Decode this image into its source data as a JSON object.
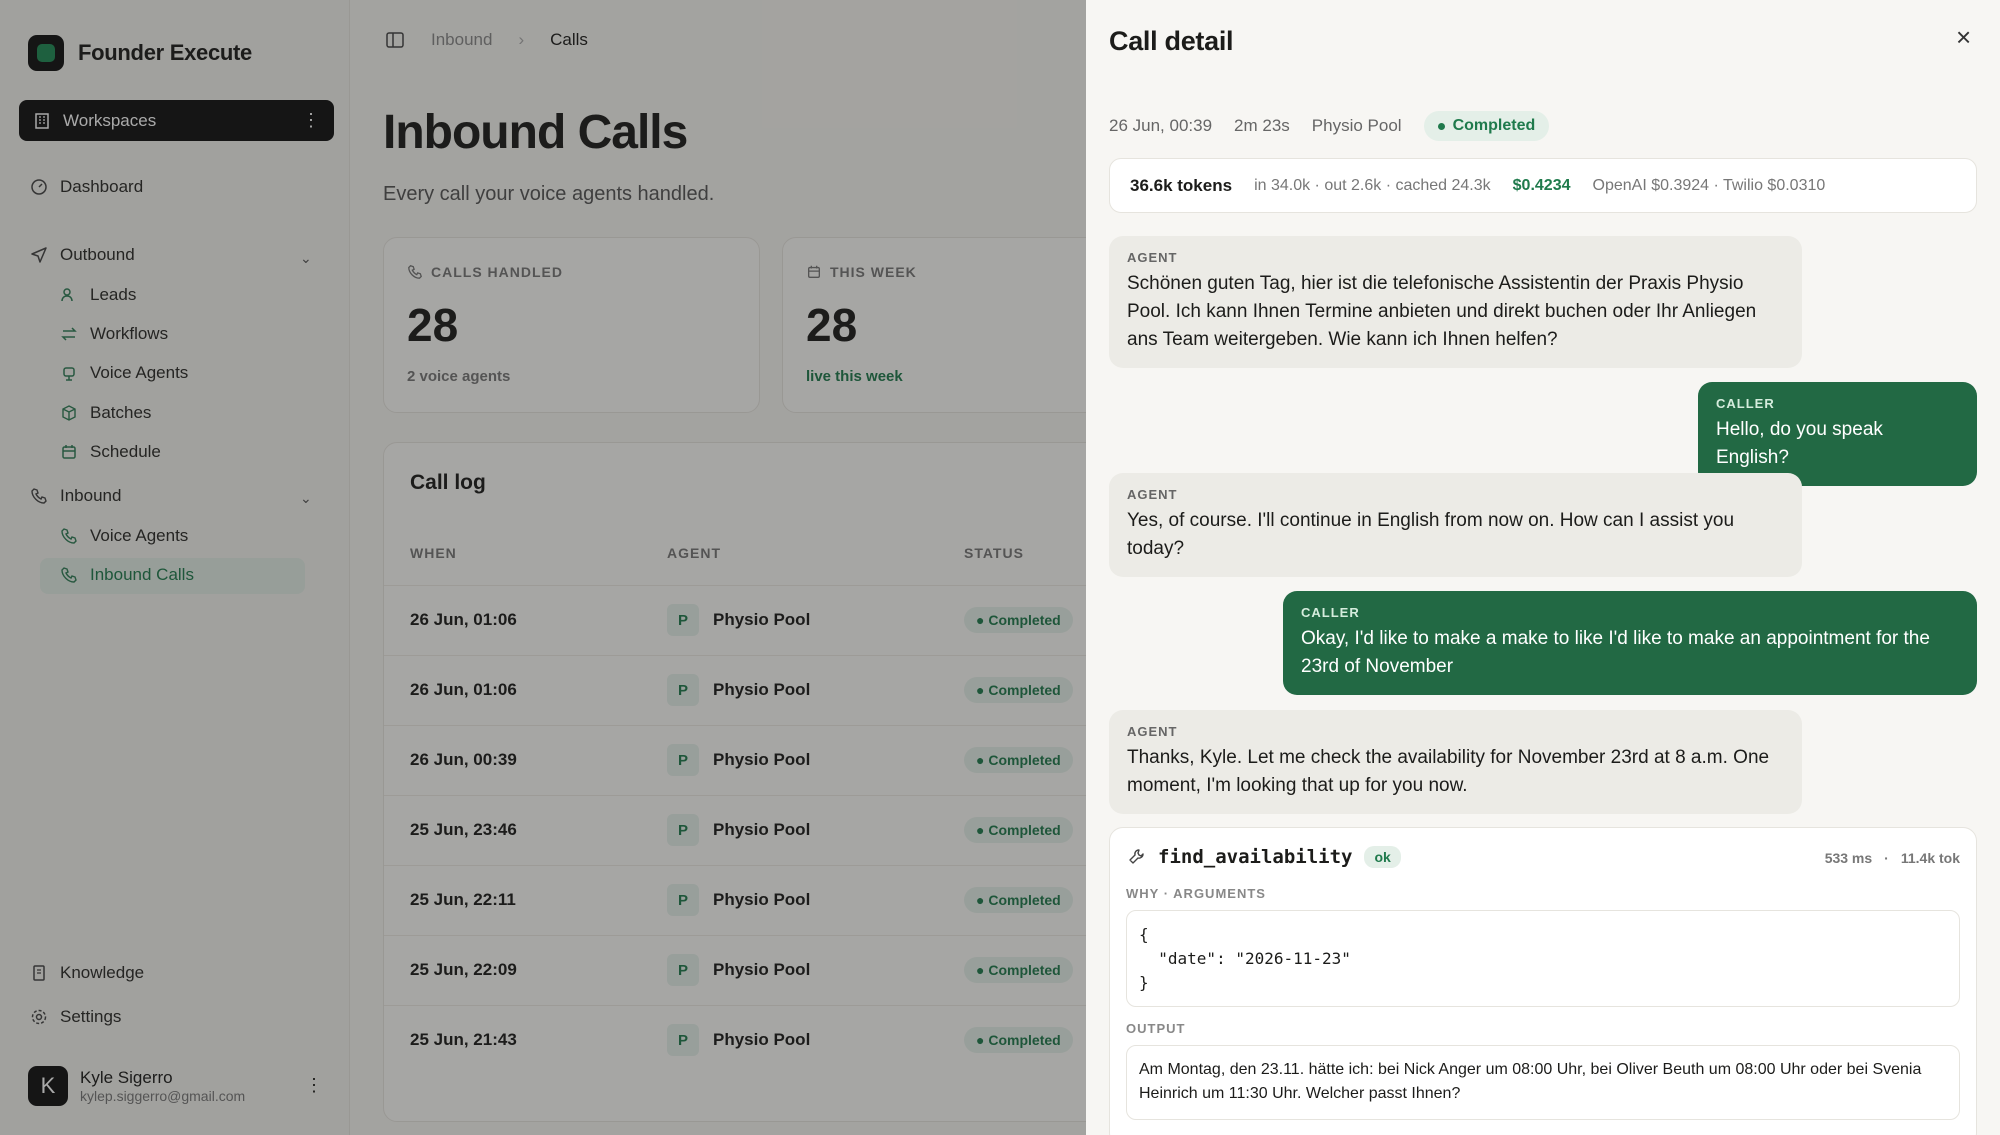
{
  "sidebar": {
    "brand": "Founder Execute",
    "workspace_label": "Workspaces",
    "dashboard": "Dashboard",
    "outbound": {
      "label": "Outbound",
      "items": [
        "Leads",
        "Workflows",
        "Voice Agents",
        "Batches",
        "Schedule"
      ]
    },
    "inbound": {
      "label": "Inbound",
      "items": [
        "Voice Agents",
        "Inbound Calls"
      ]
    },
    "knowledge": "Knowledge",
    "settings": "Settings",
    "user": {
      "initial": "K",
      "name": "Kyle Sigerro",
      "email": "kylep.siggerro@gmail.com"
    }
  },
  "breadcrumb": [
    "Inbound",
    "Calls"
  ],
  "page": {
    "title": "Inbound Calls",
    "subtitle": "Every call your voice agents handled."
  },
  "stats": [
    {
      "label": "CALLS HANDLED",
      "value": "28",
      "note": "2 voice agents"
    },
    {
      "label": "THIS WEEK",
      "value": "28",
      "note": "live this week"
    }
  ],
  "call_log": {
    "title": "Call log",
    "columns": [
      "WHEN",
      "AGENT",
      "STATUS"
    ],
    "rows": [
      {
        "when": "26 Jun, 01:06",
        "agent_initial": "P",
        "agent": "Physio Pool",
        "status": "Completed"
      },
      {
        "when": "26 Jun, 01:06",
        "agent_initial": "P",
        "agent": "Physio Pool",
        "status": "Completed"
      },
      {
        "when": "26 Jun, 00:39",
        "agent_initial": "P",
        "agent": "Physio Pool",
        "status": "Completed"
      },
      {
        "when": "25 Jun, 23:46",
        "agent_initial": "P",
        "agent": "Physio Pool",
        "status": "Completed"
      },
      {
        "when": "25 Jun, 22:11",
        "agent_initial": "P",
        "agent": "Physio Pool",
        "status": "Completed"
      },
      {
        "when": "25 Jun, 22:09",
        "agent_initial": "P",
        "agent": "Physio Pool",
        "status": "Completed"
      },
      {
        "when": "25 Jun, 21:43",
        "agent_initial": "P",
        "agent": "Physio Pool",
        "status": "Completed"
      }
    ]
  },
  "detail": {
    "title": "Call detail",
    "when": "26 Jun, 00:39",
    "duration": "2m 23s",
    "agent": "Physio Pool",
    "status": "Completed",
    "tokens": {
      "total": "36.6k tokens",
      "breakdown": "in 34.0k · out 2.6k · cached 24.3k",
      "cost": "$0.4234",
      "providers": "OpenAI $0.3924 · Twilio $0.0310"
    },
    "messages": [
      {
        "role": "AGENT",
        "text": "Schönen guten Tag, hier ist die telefonische Assistentin der Praxis Physio Pool. Ich kann Ihnen Termine anbieten und direkt buchen oder Ihr Anliegen ans Team weitergeben. Wie kann ich Ihnen helfen?"
      },
      {
        "role": "CALLER",
        "text": "Hello, do you speak English?"
      },
      {
        "role": "AGENT",
        "text": "Yes, of course. I'll continue in English from now on. How can I assist you today?"
      },
      {
        "role": "CALLER",
        "text": "Okay, I'd like to make a make to like I'd like to make an appointment for the 23rd of November"
      },
      {
        "role": "AGENT",
        "text": "Thanks, Kyle. Let me check the availability for November 23rd at 8 a.m. One moment, I'm looking that up for you now."
      }
    ],
    "tool": {
      "name": "find_availability",
      "status": "ok",
      "latency": "533 ms",
      "tokens": "11.4k tok",
      "args_label": "WHY · ARGUMENTS",
      "args": "{\n  \"date\": \"2026-11-23\"\n}",
      "output_label": "OUTPUT",
      "output": "Am Montag, den 23.11. hätte ich: bei Nick Anger um 08:00 Uhr, bei Oliver Beuth um 08:00 Uhr oder bei Svenia Heinrich um 11:30 Uhr. Welcher passt Ihnen?"
    }
  },
  "colors": {
    "accent": "#1f7a4c",
    "caller_bubble": "#226944",
    "overlay": "#1e1e1c"
  }
}
